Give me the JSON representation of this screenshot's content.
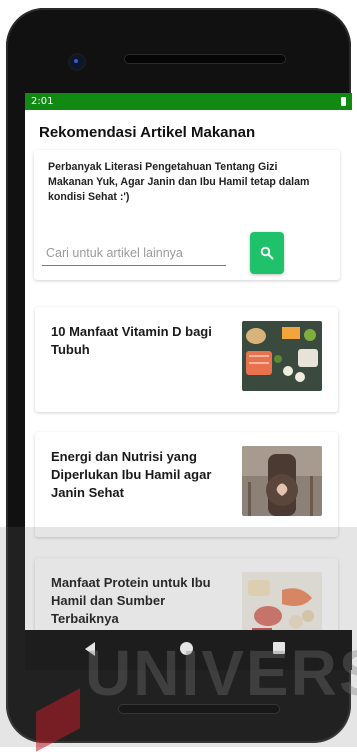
{
  "status_bar": {
    "time": "2:01"
  },
  "page": {
    "title": "Rekomendasi Artikel Makanan"
  },
  "intro": {
    "text": "Perbanyak Literasi Pengetahuan Tentang Gizi Makanan Yuk, Agar Janin dan Ibu Hamil tetap dalam kondisi Sehat :')"
  },
  "search": {
    "placeholder": "Cari untuk artikel lainnya",
    "value": "",
    "button_icon": "search-icon"
  },
  "articles": [
    {
      "title": "10 Manfaat Vitamin D bagi Tubuh",
      "thumbnail_icon": "vitamin-d-food-image"
    },
    {
      "title": "Energi dan Nutrisi yang Diperlukan Ibu Hamil agar Janin Sehat",
      "thumbnail_icon": "pregnant-woman-image"
    },
    {
      "title": "Manfaat Protein untuk Ibu Hamil dan Sumber Terbaiknya",
      "thumbnail_icon": "protein-food-image"
    }
  ],
  "nav": {
    "back_icon": "back-icon",
    "home_icon": "home-icon",
    "recent_icon": "recent-apps-icon"
  },
  "watermark": {
    "text": "UNIVERS"
  },
  "colors": {
    "status_bar": "#108a12",
    "search_button": "#1fc16b"
  }
}
